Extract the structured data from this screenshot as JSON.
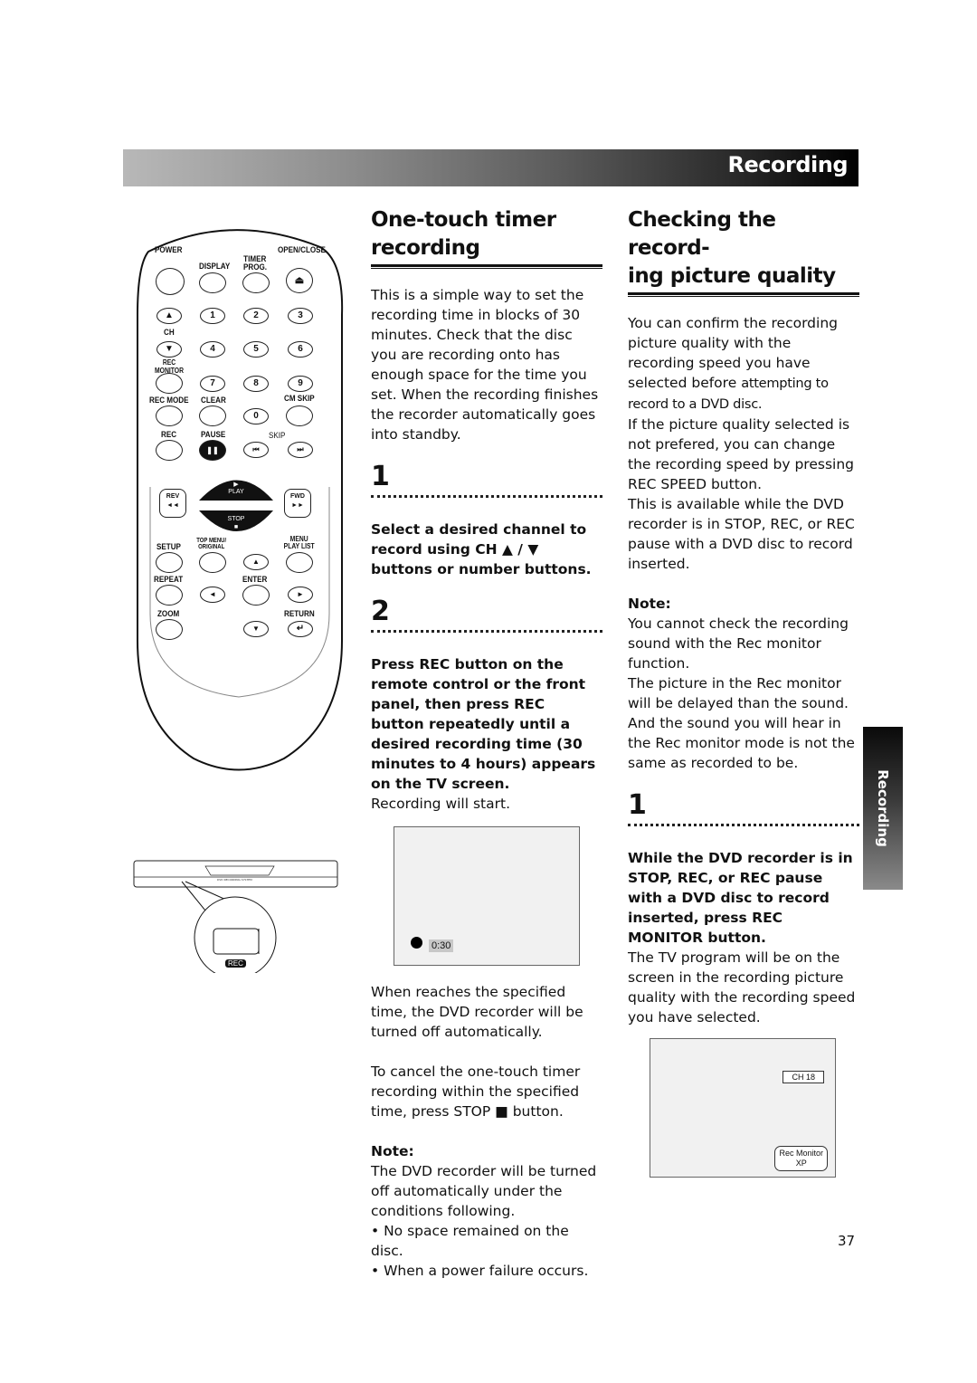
{
  "header": {
    "title": "Recording"
  },
  "side_tab": {
    "label": "Recording"
  },
  "page_number": "37",
  "remote": {
    "labels": {
      "power": "POWER",
      "display": "DISPLAY",
      "timer_prog": "TIMER PROG.",
      "open_close": "OPEN/CLOSE",
      "ch": "CH",
      "rec_monitor": "REC MONITOR",
      "rec_mode": "REC MODE",
      "clear": "CLEAR",
      "cm_skip": "CM SKIP",
      "rec": "REC",
      "pause": "PAUSE",
      "skip": "SKIP",
      "rev": "REV",
      "play": "PLAY",
      "fwd": "FWD",
      "stop": "STOP",
      "setup": "SETUP",
      "top_menu": "TOP MENU/ ORIGINAL",
      "menu": "MENU PLAY LIST",
      "repeat": "REPEAT",
      "enter": "ENTER",
      "zoom": "ZOOM",
      "return": "RETURN"
    },
    "digits": [
      "1",
      "2",
      "3",
      "4",
      "5",
      "6",
      "7",
      "8",
      "9",
      "0"
    ],
    "icons": {
      "eject": "⏏",
      "up": "▲",
      "down": "▼",
      "left": "◄",
      "right": "►",
      "pause": "❚❚",
      "prev": "⏮",
      "next": "⏭",
      "rev": "◄◄",
      "fwd": "►►",
      "play": "▶",
      "stop": "■",
      "return": "↵"
    }
  },
  "recorder": {
    "rec_label": "REC",
    "front_text": "DVD RECORDING SYSTEM"
  },
  "one_touch": {
    "title_line1": "One-touch timer",
    "title_line2": "recording",
    "intro": "This is a simple way to set the recording time in blocks of 30 minutes. Check that the disc you are recording onto has enough space for the time you set. When the recording finishes the recorder automatically goes into standby.",
    "steps": [
      {
        "number": "1",
        "instruction": "Select a desired channel to record using CH ▲ / ▼ buttons or number buttons."
      },
      {
        "number": "2",
        "instruction": "Press REC button on the remote control or the front panel, then press REC button repeatedly until a desired recording time (30 minutes to 4 hours) appears on the TV screen.",
        "detail": "Recording will start."
      }
    ],
    "screen": {
      "time": "0:30"
    },
    "after_text": "When reaches the specified time, the DVD recorder will be turned off automatically.",
    "cancel_text": "To cancel the one-touch timer recording within the specified time, press STOP ■ button.",
    "note_heading": "Note:",
    "note_text": "The DVD recorder will be turned off automatically under the conditions following.",
    "note_bullets": [
      "• No space remained on the disc.",
      "• When a power failure occurs."
    ]
  },
  "checking": {
    "title_line1": "Checking the record-",
    "title_line2": "ing picture quality",
    "intro_a": "You can confirm the recording picture quality with the recording speed you have selected before",
    "intro_b": "attempting to record to a DVD disc.",
    "intro_c": "If the picture quality selected is not prefered, you can change the recording speed by pressing REC SPEED button.",
    "intro_d": "This is available while the DVD recorder is in STOP, REC, or REC pause with a DVD disc to record inserted.",
    "note_heading": "Note:",
    "note_text": "You cannot check the recording sound with the Rec monitor function.",
    "note_text2": "The picture in the Rec monitor will be delayed than the sound. And the sound you will hear in the Rec monitor mode is not the same as recorded to be.",
    "step": {
      "number": "1",
      "instruction": "While the DVD recorder is in STOP, REC, or REC pause with a DVD disc to record inserted, press REC MONITOR button.",
      "detail": "The TV program will be on the screen in the recording picture quality with the recording speed you have selected."
    },
    "screen": {
      "channel": "CH 18",
      "mode_line1": "Rec Monitor",
      "mode_line2": "XP"
    }
  }
}
